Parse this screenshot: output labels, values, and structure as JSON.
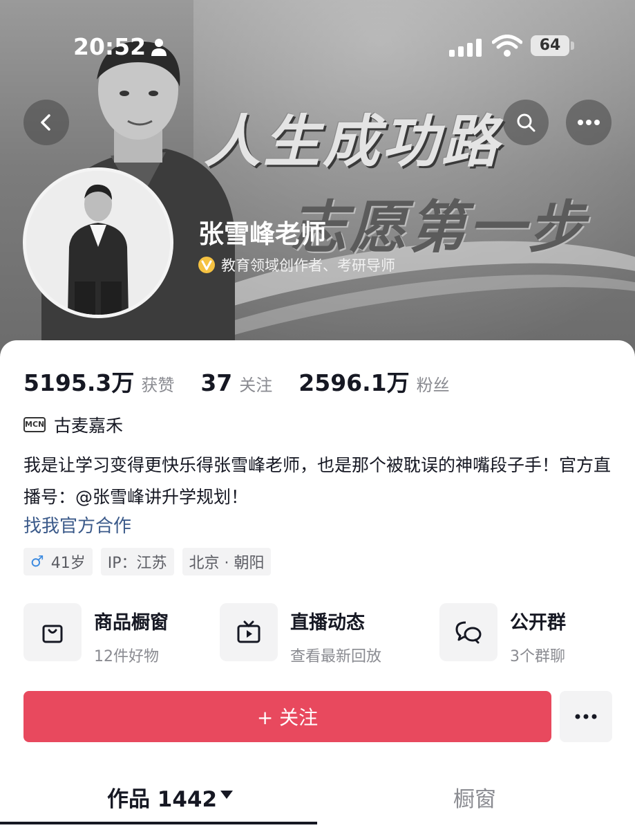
{
  "status_bar": {
    "time": "20:52",
    "battery": "64"
  },
  "banner": {
    "line1": "人生成功路",
    "line2": "志愿第一步"
  },
  "profile": {
    "name": "张雪峰老师",
    "verification": "教育领域创作者、考研导师"
  },
  "stats": [
    {
      "value": "5195.3万",
      "label": "获赞"
    },
    {
      "value": "37",
      "label": "关注"
    },
    {
      "value": "2596.1万",
      "label": "粉丝"
    }
  ],
  "mcn": {
    "badge": "MCN",
    "name": "古麦嘉禾"
  },
  "bio": {
    "text": "我是让学习变得更快乐得张雪峰老师，也是那个被耽误的神嘴段子手！官方直播号：@张雪峰讲升学规划！",
    "link": "找我官方合作"
  },
  "tags": {
    "gender": "♂",
    "age": "41岁",
    "ip": "IP：江苏",
    "location": "北京 · 朝阳"
  },
  "features": [
    {
      "title": "商品橱窗",
      "subtitle": "12件好物",
      "icon": "shopping-bag-icon"
    },
    {
      "title": "直播动态",
      "subtitle": "查看最新回放",
      "icon": "tv-icon"
    },
    {
      "title": "公开群",
      "subtitle": "3个群聊",
      "icon": "chat-bubbles-icon"
    }
  ],
  "actions": {
    "follow": "+ 关注"
  },
  "tabs": {
    "works": "作品 1442",
    "window": "橱窗"
  },
  "colors": {
    "follow_button": "#e8495e",
    "link": "#3b5a8a",
    "gender": "#3d8be0"
  }
}
